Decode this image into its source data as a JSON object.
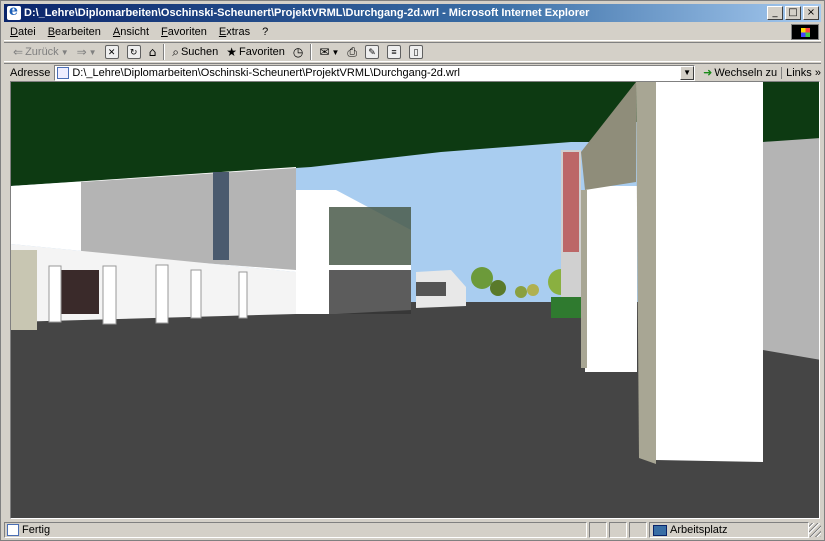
{
  "window": {
    "title": "D:\\_Lehre\\Diplomarbeiten\\Oschinski-Scheunert\\ProjektVRML\\Durchgang-2d.wrl - Microsoft Internet Explorer",
    "caption_buttons": {
      "minimize": "_",
      "maximize": "□",
      "close": "×"
    }
  },
  "menu": [
    "Datei",
    "Bearbeiten",
    "Ansicht",
    "Favoriten",
    "Extras",
    "?"
  ],
  "toolbar": {
    "back": "Zurück",
    "search": "Suchen",
    "favorites": "Favoriten"
  },
  "address": {
    "label": "Adresse",
    "value": "D:\\_Lehre\\Diplomarbeiten\\Oschinski-Scheunert\\ProjektVRML\\Durchgang-2d.wrl",
    "go_label": "Wechseln zu",
    "links_label": "Links",
    "links_chevron": "»"
  },
  "status": {
    "text": "Fertig",
    "zone": "Arbeitsplatz"
  },
  "colors": {
    "ceiling": "#0d3a12",
    "ground": "#454545",
    "sky": "#a9cdf0",
    "column_shadow": "#a8a694",
    "building_grey": "#b4b4b4"
  }
}
